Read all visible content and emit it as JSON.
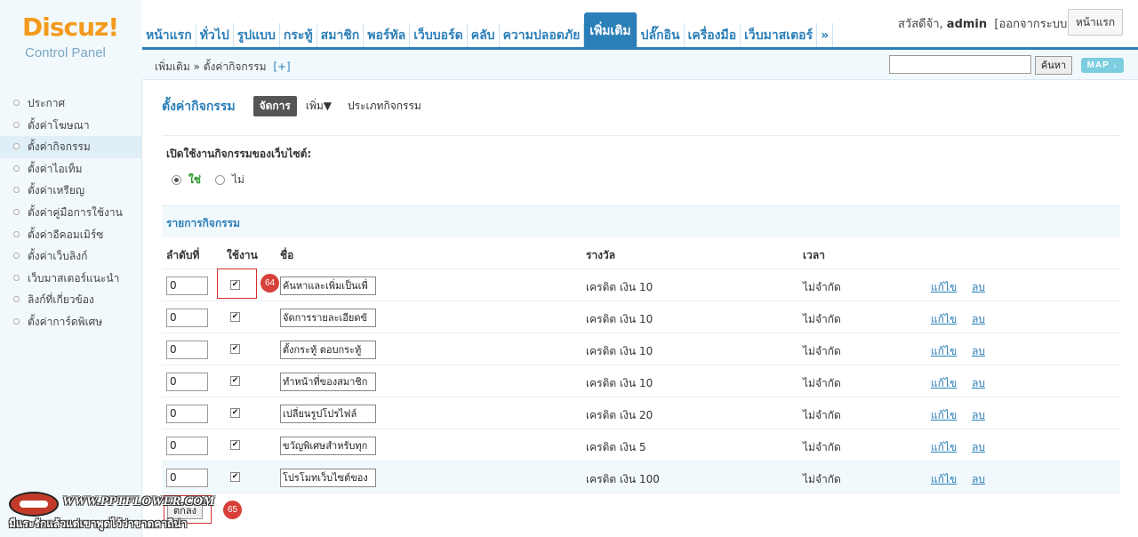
{
  "logo": {
    "brand": "Discuz!",
    "subtitle": "Control Panel"
  },
  "topnav": {
    "tabs": [
      {
        "label": "หน้าแรก"
      },
      {
        "label": "ทั่วไป"
      },
      {
        "label": "รูปแบบ"
      },
      {
        "label": "กระทู้"
      },
      {
        "label": "สมาชิก"
      },
      {
        "label": "พอร์ทัล"
      },
      {
        "label": "เว็บบอร์ด"
      },
      {
        "label": "คลับ"
      },
      {
        "label": "ความปลอดภัย"
      },
      {
        "label": "เพิ่มเติม",
        "active": true
      },
      {
        "label": "ปลั๊กอิน"
      },
      {
        "label": "เครื่องมือ"
      },
      {
        "label": "เว็บมาสเตอร์"
      },
      {
        "label": "»"
      }
    ]
  },
  "user": {
    "greeting": "สวัสดีจ้า, ",
    "name": "admin",
    "logout": "[ออกจากระบบ]",
    "home_button": "หน้าแรก"
  },
  "subbar": {
    "breadcrumb": "เพิ่มเติม » ตั้งค่ากิจกรรม",
    "plus": "[+]",
    "search_value": "",
    "search_button": "ค้นหา",
    "map_button": "MAP ↓"
  },
  "sidebar": {
    "items": [
      {
        "label": "ประกาศ"
      },
      {
        "label": "ตั้งค่าโฆษณา"
      },
      {
        "label": "ตั้งค่ากิจกรรม",
        "active": true
      },
      {
        "label": "ตั้งค่าไอเท็ม"
      },
      {
        "label": "ตั้งค่าเหรียญ"
      },
      {
        "label": "ตั้งค่าคู่มือการใช้งาน"
      },
      {
        "label": "ตั้งค่าอีคอมเมิร์ซ"
      },
      {
        "label": "ตั้งค่าเว็บลิงก์"
      },
      {
        "label": "เว็บมาสเตอร์แนะนำ"
      },
      {
        "label": "ลิงก์ที่เกี่ยวข้อง"
      },
      {
        "label": "ตั้งค่าการ์ดพิเศษ"
      }
    ]
  },
  "main": {
    "title": "ตั้งค่ากิจกรรม",
    "manage_button": "จัดการ",
    "add_menu": "เพิ่ม▼",
    "types_link": "ประเภทกิจกรรม",
    "enable_label": "เปิดใช้งานกิจกรรมของเว็บไซต์:",
    "radio_yes": "ใช่",
    "radio_no": "ไม่",
    "list_heading": "รายการกิจกรรม",
    "columns": {
      "order": "ลำดับที่",
      "enabled": "ใช้งาน",
      "name": "ชื่อ",
      "reward": "รางวัล",
      "time": "เวลา"
    },
    "rows": [
      {
        "order": "0",
        "enabled": true,
        "name": "ค้นหาและเพิ่มเป็นเพื่",
        "reward": "เครดิต เงิน 10",
        "time": "ไม่จำกัด",
        "edit": "แก้ไข",
        "delete": "ลบ"
      },
      {
        "order": "0",
        "enabled": true,
        "name": "จัดการรายละเอียดข้",
        "reward": "เครดิต เงิน 10",
        "time": "ไม่จำกัด",
        "edit": "แก้ไข",
        "delete": "ลบ"
      },
      {
        "order": "0",
        "enabled": true,
        "name": "ตั้งกระทู้ ตอบกระทู้",
        "reward": "เครดิต เงิน 10",
        "time": "ไม่จำกัด",
        "edit": "แก้ไข",
        "delete": "ลบ"
      },
      {
        "order": "0",
        "enabled": true,
        "name": "ทำหน้าที่ของสมาชิก",
        "reward": "เครดิต เงิน 10",
        "time": "ไม่จำกัด",
        "edit": "แก้ไข",
        "delete": "ลบ"
      },
      {
        "order": "0",
        "enabled": true,
        "name": "เปลี่ยนรูปโปรไฟล์",
        "reward": "เครดิต เงิน 20",
        "time": "ไม่จำกัด",
        "edit": "แก้ไข",
        "delete": "ลบ"
      },
      {
        "order": "0",
        "enabled": true,
        "name": "ขวัญพิเศษสำหรับทุก",
        "reward": "เครดิต เงิน 5",
        "time": "ไม่จำกัด",
        "edit": "แก้ไข",
        "delete": "ลบ"
      },
      {
        "order": "0",
        "enabled": true,
        "name": "โปรโมทเว็บไซต์ของ",
        "reward": "เครดิต เงิน 100",
        "time": "ไม่จำกัด",
        "edit": "แก้ไข",
        "delete": "ลบ"
      }
    ],
    "submit_button": "ตกลง"
  },
  "annotations": {
    "marker_64": "64",
    "marker_65": "65"
  },
  "watermark": {
    "url": "WWW.PPTFLOWER.COM",
    "caption": "มีแระรักแล้วแต่เขาพูดไว้ว่าขาดคาถิน่า"
  },
  "colors": {
    "accent": "#2b7fb8",
    "logo_orange": "#f39a1e",
    "highlight_red": "#d62f2f",
    "yes_green": "#2a9a2a"
  }
}
